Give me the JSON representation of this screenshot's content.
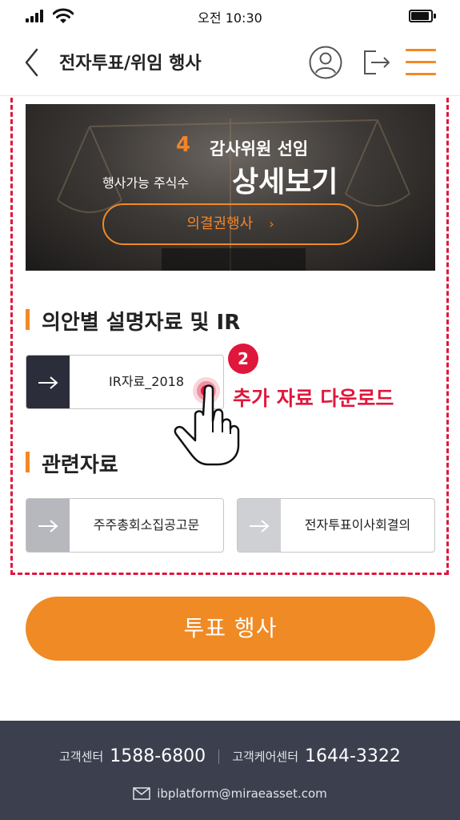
{
  "status_bar": {
    "time": "오전 10:30",
    "signal_icon": "signal-icon",
    "wifi_icon": "wifi-icon",
    "battery_icon": "battery-icon"
  },
  "header": {
    "title": "전자투표/위임 행사",
    "back_icon": "chevron-left-icon",
    "profile_icon": "profile-icon",
    "logout_icon": "logout-icon",
    "menu_icon": "hamburger-menu-icon"
  },
  "banner": {
    "agenda_number": "4",
    "agenda_title": "감사위원 선임",
    "shares_label": "행사가능 주식수",
    "detail_link": "상세보기",
    "vote_button_label": "의결권행사",
    "vote_button_chevron": "›"
  },
  "ir_section": {
    "title": "의안별 설명자료 및 IR",
    "files": [
      {
        "label": "IR자료_2018",
        "icon": "arrow-right-icon"
      }
    ]
  },
  "related_section": {
    "title": "관련자료",
    "files": [
      {
        "label": "주주총회소집공고문",
        "icon": "arrow-right-icon"
      },
      {
        "label": "전자투표이사회결의",
        "icon": "arrow-right-icon"
      }
    ]
  },
  "annotation": {
    "step": "2",
    "text": "추가 자료 다운로드"
  },
  "vote_button": {
    "label": "투표 행사"
  },
  "footer": {
    "customer_center_label": "고객센터",
    "customer_center_number": "1588-6800",
    "care_center_label": "고객케어센터",
    "care_center_number": "1644-3322",
    "email": "ibplatform@miraeasset.com",
    "email_icon": "mail-icon"
  },
  "colors": {
    "accent": "#f08a24",
    "highlight": "#e0173c",
    "footer_bg": "#3c3f4e",
    "arrow_box_dark": "#2b2d3a",
    "arrow_box_grey": "#b7b8bd"
  }
}
